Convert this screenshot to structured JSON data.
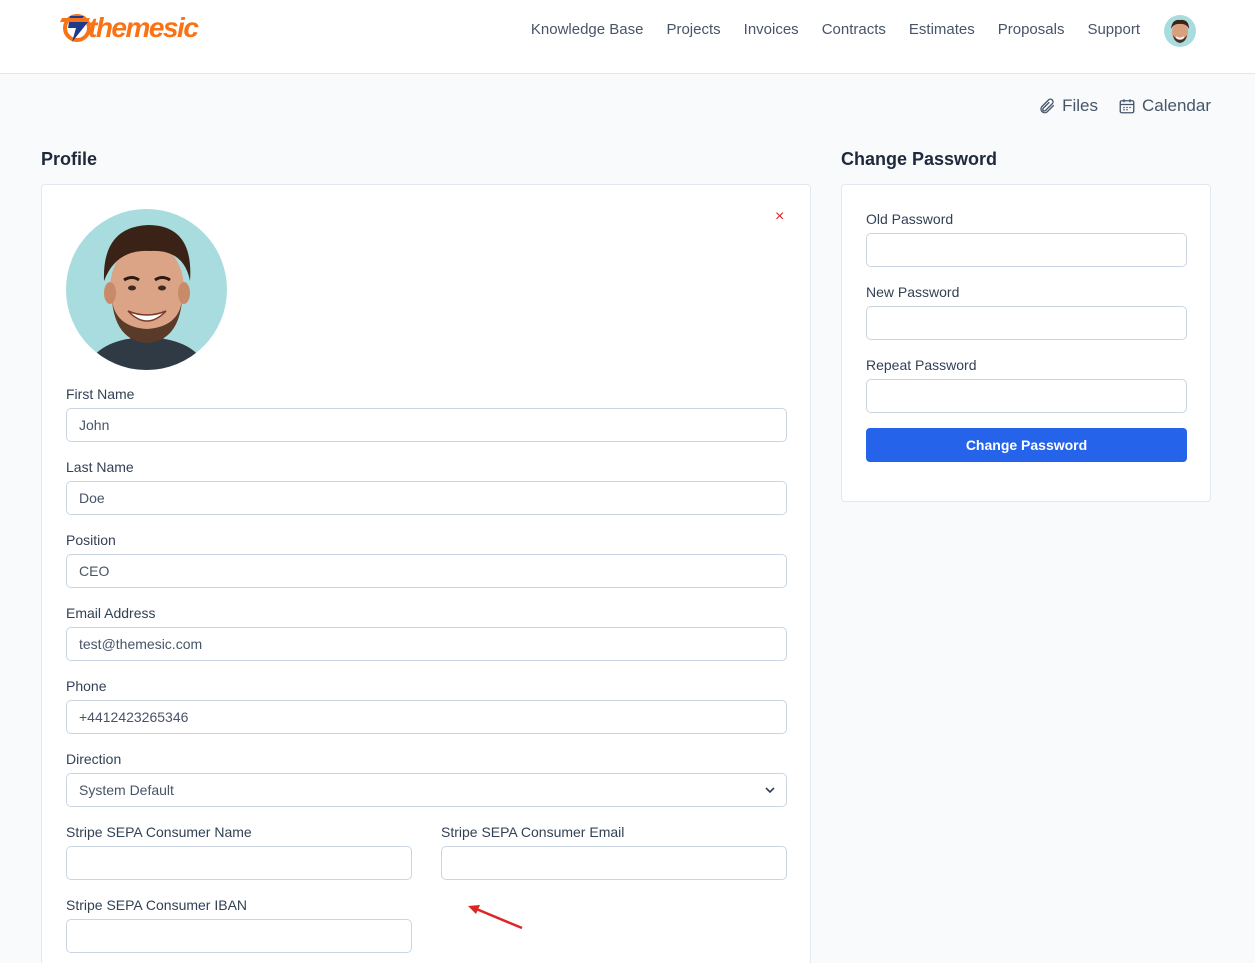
{
  "brand": {
    "name": "themesic",
    "accent": "#f97316"
  },
  "nav": {
    "items": [
      "Knowledge Base",
      "Projects",
      "Invoices",
      "Contracts",
      "Estimates",
      "Proposals",
      "Support"
    ]
  },
  "quick_links": {
    "files": "Files",
    "calendar": "Calendar"
  },
  "profile": {
    "title": "Profile",
    "remove_label": "×",
    "fields": {
      "first_name": {
        "label": "First Name",
        "value": "John"
      },
      "last_name": {
        "label": "Last Name",
        "value": "Doe"
      },
      "position": {
        "label": "Position",
        "value": "CEO"
      },
      "email": {
        "label": "Email Address",
        "value": "test@themesic.com"
      },
      "phone": {
        "label": "Phone",
        "value": "+4412423265346"
      },
      "direction": {
        "label": "Direction",
        "value": "System Default"
      },
      "sepa_name": {
        "label": "Stripe SEPA Consumer Name",
        "value": ""
      },
      "sepa_email": {
        "label": "Stripe SEPA Consumer Email",
        "value": ""
      },
      "sepa_iban": {
        "label": "Stripe SEPA Consumer IBAN",
        "value": ""
      }
    }
  },
  "password": {
    "title": "Change Password",
    "old_label": "Old Password",
    "new_label": "New Password",
    "repeat_label": "Repeat Password",
    "submit": "Change Password",
    "button_color": "#2563eb"
  },
  "annotation": {
    "arrow_color": "#dc2626"
  }
}
